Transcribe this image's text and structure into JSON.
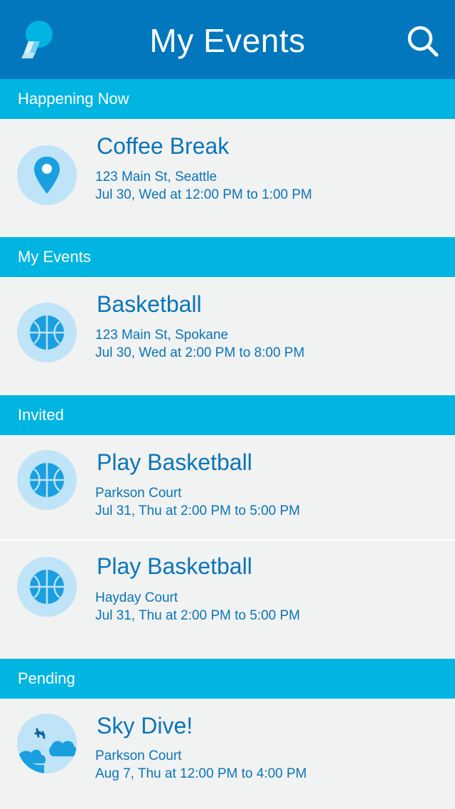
{
  "header": {
    "title": "My Events",
    "logo_icon": "chat-bubble-logo",
    "search_icon": "search-icon"
  },
  "colors": {
    "header_bg": "#0277bd",
    "section_bg": "#00b5e2",
    "row_bg": "#f1f2f2",
    "text_blue": "#0a75b8",
    "icon_circle": "#bfe3f7",
    "icon_blue": "#1a9fe0"
  },
  "sections": [
    {
      "label": "Happening Now"
    },
    {
      "label": "My Events"
    },
    {
      "label": "Invited"
    },
    {
      "label": "Pending"
    }
  ],
  "events": [
    {
      "name": "Coffee Break",
      "address": "123 Main St, Seattle",
      "time": "Jul 30, Wed at 12:00 PM to 1:00 PM",
      "icon": "map-pin-icon"
    },
    {
      "name": "Basketball",
      "address": "123 Main St, Spokane",
      "time": "Jul 30, Wed at 2:00 PM to 8:00 PM",
      "icon": "basketball-icon"
    },
    {
      "name": "Play Basketball",
      "address": "Parkson Court",
      "time": "Jul 31, Thu at 2:00 PM to 5:00 PM",
      "icon": "basketball-icon"
    },
    {
      "name": "Play Basketball",
      "address": "Hayday Court",
      "time": "Jul 31, Thu at 2:00 PM to 5:00 PM",
      "icon": "basketball-icon"
    },
    {
      "name": "Sky Dive!",
      "address": "Parkson Court",
      "time": "Aug 7, Thu at 12:00 PM to 4:00 PM",
      "icon": "skydiver-clouds-icon"
    }
  ]
}
